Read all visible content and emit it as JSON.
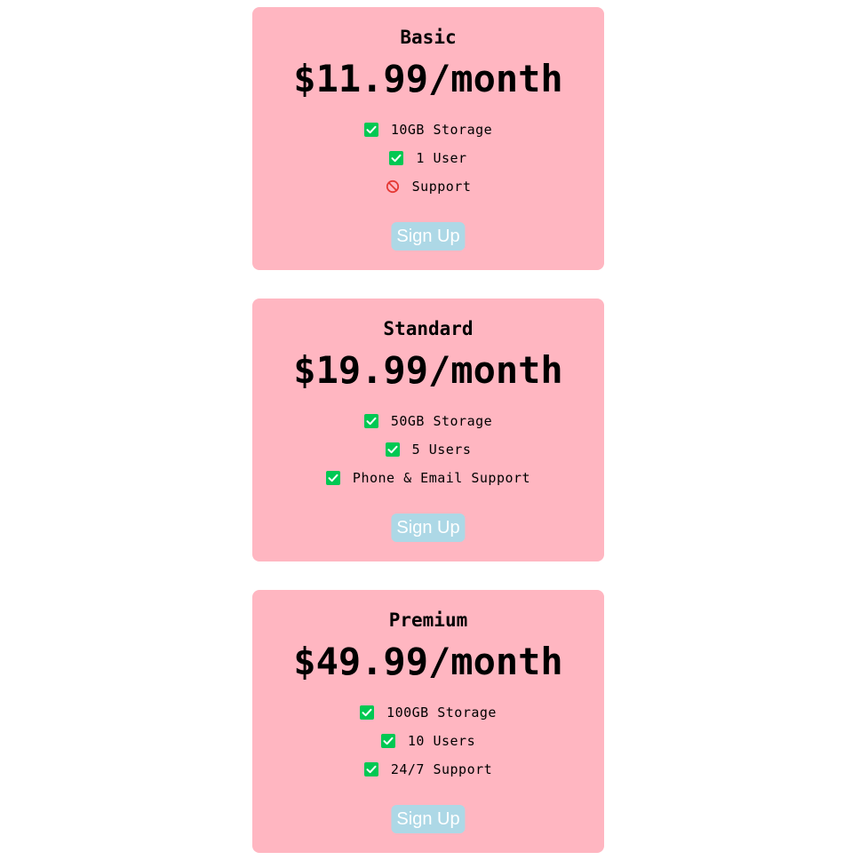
{
  "plans": [
    {
      "name": "Basic",
      "price": "$11.99/month",
      "features": [
        {
          "text": "10GB Storage",
          "icon": "check-icon",
          "included": true
        },
        {
          "text": "1 User",
          "icon": "check-icon",
          "included": true
        },
        {
          "text": "Support",
          "icon": "prohibited-icon",
          "included": false
        }
      ],
      "button_label": "Sign Up"
    },
    {
      "name": "Standard",
      "price": "$19.99/month",
      "features": [
        {
          "text": "50GB Storage",
          "icon": "check-icon",
          "included": true
        },
        {
          "text": "5 Users",
          "icon": "check-icon",
          "included": true
        },
        {
          "text": "Phone & Email Support",
          "icon": "check-icon",
          "included": true
        }
      ],
      "button_label": "Sign Up"
    },
    {
      "name": "Premium",
      "price": "$49.99/month",
      "features": [
        {
          "text": "100GB Storage",
          "icon": "check-icon",
          "included": true
        },
        {
          "text": "10 Users",
          "icon": "check-icon",
          "included": true
        },
        {
          "text": "24/7 Support",
          "icon": "check-icon",
          "included": true
        }
      ],
      "button_label": "Sign Up"
    }
  ],
  "colors": {
    "card_background": "#ffb6c1",
    "button_background": "#add8e6",
    "button_text": "#ffffff",
    "check_icon": "#00c853",
    "prohibited_icon": "#e53935"
  }
}
